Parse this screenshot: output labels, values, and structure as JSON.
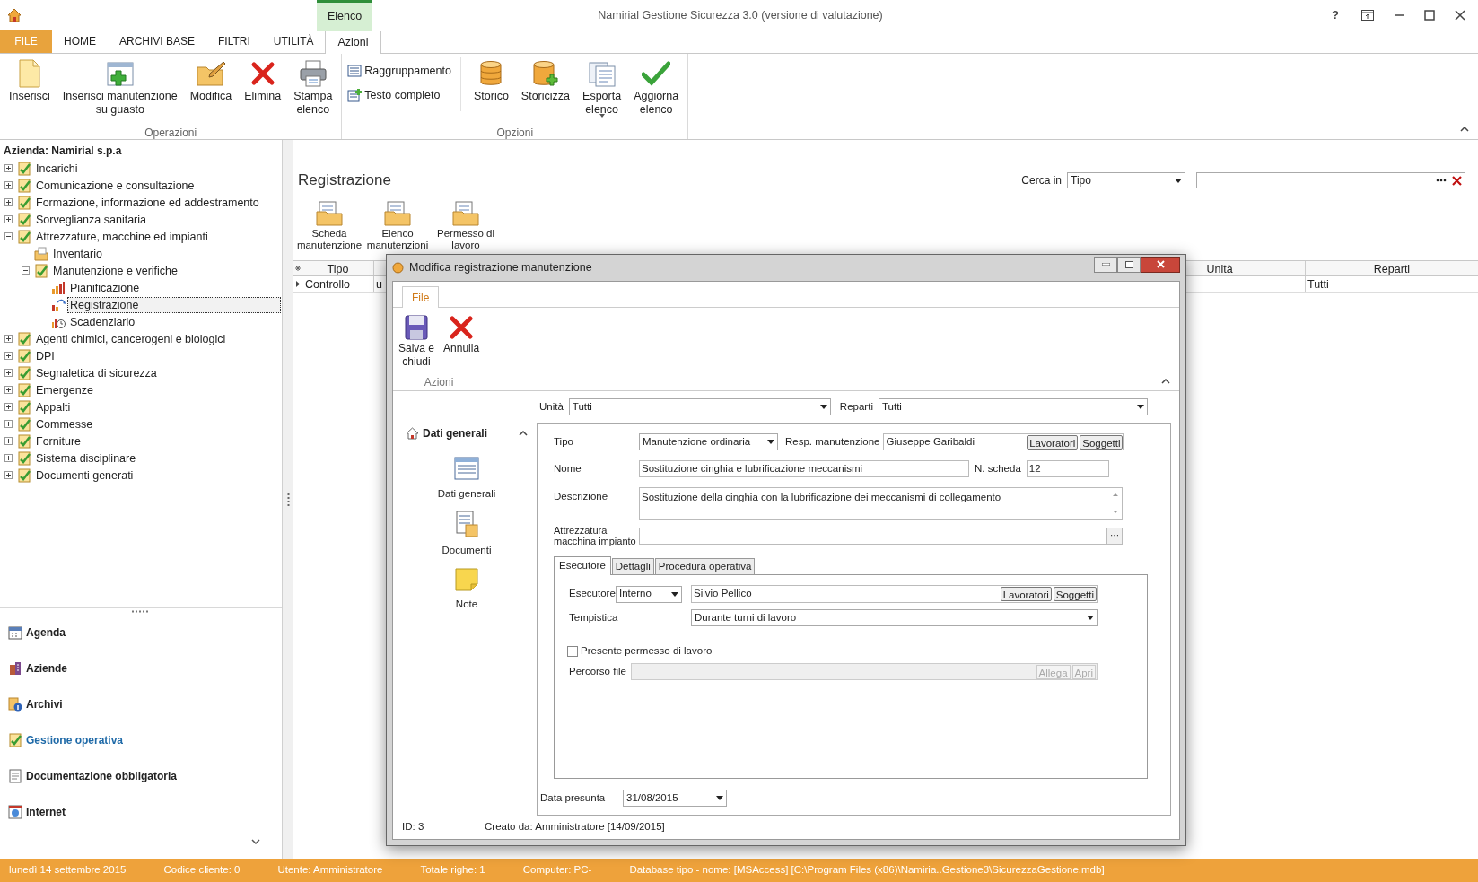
{
  "app": {
    "title": "Namirial Gestione Sicurezza 3.0 (versione di valutazione)",
    "help": "?"
  },
  "ribbon": {
    "file_tab": "FILE",
    "context_group": "Elenco",
    "tabs": [
      {
        "label": "HOME",
        "selected": false
      },
      {
        "label": "ARCHIVI BASE",
        "selected": false
      },
      {
        "label": "FILTRI",
        "selected": false
      },
      {
        "label": "UTILITÀ",
        "selected": false
      },
      {
        "label": "Azioni",
        "selected": true
      }
    ],
    "groups": [
      {
        "label": "Operazioni",
        "buttons": [
          {
            "label": "Inserisci",
            "dropdown": false
          },
          {
            "label": "Inserisci manutenzione\nsu guasto",
            "dropdown": false
          },
          {
            "label": "Modifica",
            "dropdown": false
          },
          {
            "label": "Elimina",
            "dropdown": false
          },
          {
            "label": "Stampa\nelenco",
            "dropdown": false
          }
        ]
      },
      {
        "label": "Opzioni",
        "small_buttons": [
          "Raggruppamento",
          "Testo completo"
        ],
        "buttons": [
          {
            "label": "Storico",
            "dropdown": false
          },
          {
            "label": "Storicizza",
            "dropdown": false
          },
          {
            "label": "Esporta\nelenco",
            "dropdown": true
          },
          {
            "label": "Aggiorna\nelenco",
            "dropdown": false
          }
        ]
      }
    ]
  },
  "tree": {
    "header": "Azienda: Namirial s.p.a",
    "items": [
      {
        "label": "Incarichi",
        "expanded": false,
        "selected": false
      },
      {
        "label": "Comunicazione e consultazione",
        "expanded": false,
        "selected": false
      },
      {
        "label": "Formazione, informazione ed addestramento",
        "expanded": false,
        "selected": false
      },
      {
        "label": "Sorveglianza sanitaria",
        "expanded": false,
        "selected": false
      },
      {
        "label": "Attrezzature, macchine ed impianti",
        "expanded": true,
        "selected": false,
        "children": [
          {
            "label": "Inventario",
            "selected": false
          },
          {
            "label": "Manutenzione e verifiche",
            "expanded": true,
            "selected": false,
            "children": [
              {
                "label": "Pianificazione",
                "selected": false
              },
              {
                "label": "Registrazione",
                "selected": true
              },
              {
                "label": "Scadenziario",
                "selected": false
              }
            ]
          }
        ]
      },
      {
        "label": "Agenti chimici, cancerogeni e biologici",
        "expanded": false,
        "selected": false
      },
      {
        "label": "DPI",
        "expanded": false,
        "selected": false
      },
      {
        "label": "Segnaletica di sicurezza",
        "expanded": false,
        "selected": false
      },
      {
        "label": "Emergenze",
        "expanded": false,
        "selected": false
      },
      {
        "label": "Appalti",
        "expanded": false,
        "selected": false
      },
      {
        "label": "Commesse",
        "expanded": false,
        "selected": false
      },
      {
        "label": "Forniture",
        "expanded": false,
        "selected": false
      },
      {
        "label": "Sistema disciplinare",
        "expanded": false,
        "selected": false
      },
      {
        "label": "Documenti generati",
        "expanded": false,
        "selected": false
      }
    ]
  },
  "nav": [
    {
      "label": "Agenda",
      "selected": false
    },
    {
      "label": "Aziende",
      "selected": false
    },
    {
      "label": "Archivi",
      "selected": false
    },
    {
      "label": "Gestione operativa",
      "selected": true
    },
    {
      "label": "Documentazione obbligatoria",
      "selected": false
    },
    {
      "label": "Internet",
      "selected": false
    }
  ],
  "main": {
    "title": "Registrazione",
    "search": {
      "label": "Cerca in",
      "field": "Tipo"
    },
    "toolbar": [
      {
        "label": "Scheda\nmanutenzione"
      },
      {
        "label": "Elenco\nmanutenzioni"
      },
      {
        "label": "Permesso di\nlavoro"
      }
    ],
    "grid": {
      "columns": {
        "tipo": "Tipo",
        "unita": "Unità",
        "reparti": "Reparti"
      },
      "rows": [
        {
          "tipo": "Controllo",
          "column_2": "u",
          "reparti": "Tutti",
          "selected": true
        }
      ]
    }
  },
  "dialog": {
    "title": "Modifica registrazione manutenzione",
    "ribbon": {
      "tab": "File",
      "group": "Azioni",
      "buttons": [
        {
          "label": "Salva e\nchiudi"
        },
        {
          "label": "Annulla"
        }
      ]
    },
    "unita": {
      "label": "Unità",
      "value": "Tutti"
    },
    "reparti": {
      "label": "Reparti",
      "value": "Tutti"
    },
    "sidebar": {
      "title": "Dati generali",
      "expanded": true,
      "items": [
        {
          "label": "Dati generali"
        },
        {
          "label": "Documenti"
        },
        {
          "label": "Note"
        }
      ]
    },
    "tipo": {
      "label": "Tipo",
      "value": "Manutenzione ordinaria"
    },
    "resp": {
      "label": "Resp. manutenzione",
      "value": "Giuseppe Garibaldi",
      "buttons": [
        "Lavoratori",
        "Soggetti"
      ]
    },
    "nome": {
      "label": "Nome",
      "value": "Sostituzione cinghia e lubrificazione meccanismi"
    },
    "n_scheda": {
      "label": "N. scheda",
      "value": "12"
    },
    "descrizione": {
      "label": "Descrizione",
      "value": "Sostituzione della cinghia con la lubrificazione dei meccanismi di collegamento"
    },
    "attrezzatura": {
      "label": "Attrezzatura\nmacchina impianto",
      "button": "···"
    },
    "tabs": [
      {
        "label": "Esecutore",
        "selected": true
      },
      {
        "label": "Dettagli",
        "selected": false
      },
      {
        "label": "Procedura operativa",
        "selected": false
      }
    ],
    "esecutore": {
      "label": "Esecutore",
      "mode": "Interno",
      "value": "Silvio Pellico",
      "buttons": [
        "Lavoratori",
        "Soggetti"
      ]
    },
    "tempistica": {
      "label": "Tempistica",
      "value": "Durante turni di lavoro"
    },
    "permesso": {
      "label": "Presente permesso di lavoro",
      "checked": false
    },
    "percorso": {
      "label": "Percorso file",
      "disabled": true,
      "buttons": [
        "Allega",
        "Apri"
      ]
    },
    "data_presunta": {
      "label": "Data presunta",
      "value": "31/08/2015"
    },
    "footer": {
      "id": "ID: 3",
      "created": "Creato da: Amministratore [14/09/2015]"
    }
  },
  "status_bar": [
    "lunedì 14 settembre 2015",
    "Codice cliente: 0",
    "Utente: Amministratore",
    "Totale righe: 1",
    "Computer: PC-",
    "Database tipo - nome: [MSAccess] [C:\\Program Files (x86)\\Namiria..Gestione3\\SicurezzaGestione.mdb]"
  ]
}
